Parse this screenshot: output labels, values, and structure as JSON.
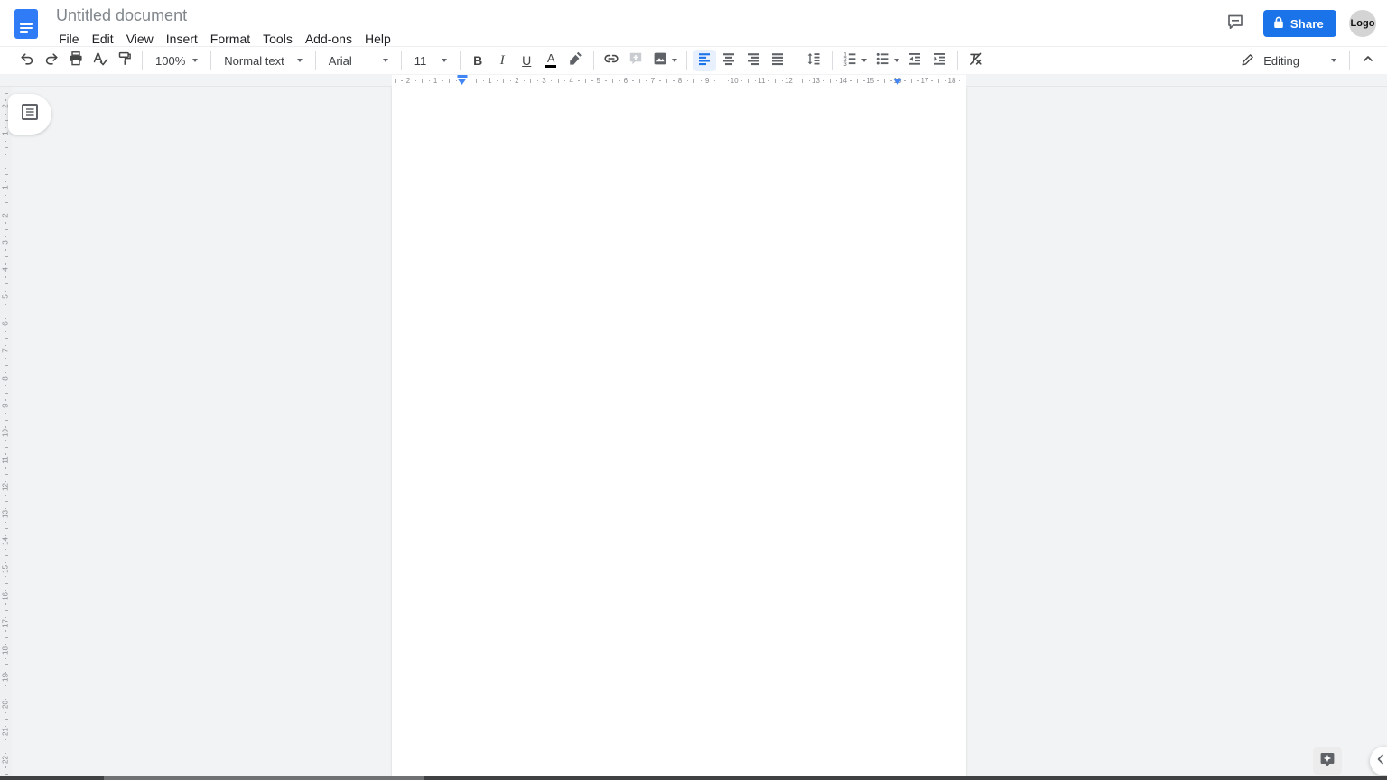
{
  "header": {
    "title": "Untitled document",
    "share_label": "Share",
    "avatar_label": "Logo"
  },
  "menubar": {
    "items": [
      "File",
      "Edit",
      "View",
      "Insert",
      "Format",
      "Tools",
      "Add-ons",
      "Help"
    ]
  },
  "toolbar": {
    "zoom": "100%",
    "paragraph_style": "Normal text",
    "font": "Arial",
    "font_size": "11",
    "mode": "Editing",
    "glyphs": {
      "bold": "B",
      "italic": "I",
      "underline": "U",
      "text_color": "A"
    }
  },
  "rulers": {
    "horizontal": {
      "labels": [
        "2",
        "1",
        "",
        "1",
        "2",
        "3",
        "4",
        "5",
        "6",
        "7",
        "8",
        "9",
        "10",
        "11",
        "12",
        "13",
        "14",
        "15",
        "16",
        "17",
        "18"
      ]
    },
    "vertical": {
      "labels": [
        "2",
        "1",
        "",
        "1",
        "2",
        "3",
        "4",
        "5",
        "6",
        "7",
        "8",
        "9",
        "10",
        "11",
        "12",
        "13",
        "14",
        "15",
        "16",
        "17",
        "18",
        "19",
        "20",
        "21",
        "22"
      ]
    }
  },
  "document": {
    "text": ""
  },
  "icons": {
    "docs-logo": "blue-document",
    "comment-history-icon": "speech-bubble",
    "share-lock-icon": "lock",
    "undo-icon": "curved-arrow-left",
    "redo-icon": "curved-arrow-right",
    "print-icon": "printer",
    "spelling-check-icon": "letter-a-with-check",
    "paint-format-icon": "paint-roller",
    "text-color-icon": "letter-a-over-color-bar",
    "highlight-color-icon": "marker-pen",
    "insert-link-icon": "chain-link",
    "add-comment-icon": "speech-bubble-plus",
    "insert-image-icon": "photo-mountain",
    "align-left-icon": "bars-align-left",
    "align-center-icon": "bars-align-center",
    "align-right-icon": "bars-align-right",
    "justify-icon": "bars-justified",
    "line-spacing-icon": "vertical-arrows-with-lines",
    "numbered-list-icon": "list-with-numbers",
    "bulleted-list-icon": "list-with-dots",
    "decrease-indent-icon": "lines-arrow-left",
    "increase-indent-icon": "lines-arrow-right",
    "clear-formatting-icon": "letter-t-slash",
    "mode-pencil-icon": "pencil",
    "hide-menus-icon": "chevron-up",
    "document-outline-icon": "boxed-list",
    "explore-icon": "four-point-star-badge",
    "hide-side-panel-icon": "chevron-left"
  },
  "colors": {
    "accent": "#1a73e8",
    "accent_light": "#e8f0fe",
    "docs_blue": "#2f7cf6",
    "icon_gray": "#5f6368",
    "canvas": "#f1f3f4",
    "ruler_marker": "#4285f4",
    "bottom_bar": "#3f4142"
  }
}
